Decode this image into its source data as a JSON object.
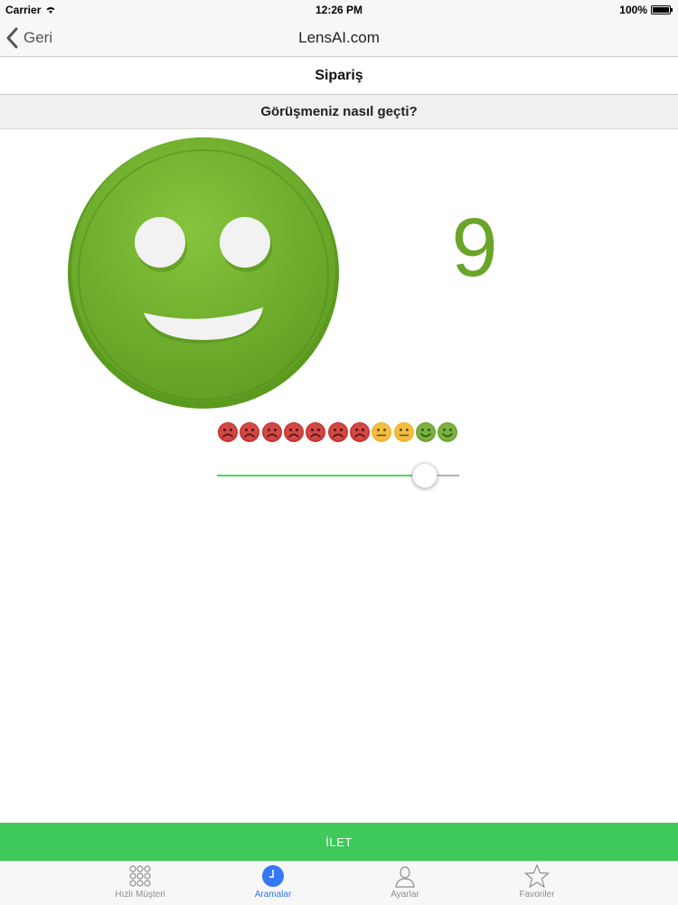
{
  "status_bar": {
    "carrier": "Carrier",
    "time": "12:26 PM",
    "battery": "100%"
  },
  "navbar": {
    "back_label": "Geri",
    "title": "LensAI.com"
  },
  "section_title": "Sipariş",
  "question": "Görüşmeniz nasıl geçti?",
  "rating": {
    "score_label": "9",
    "value": 9,
    "min": 0,
    "max": 10,
    "face": "happy-face-green",
    "scale_icons": [
      "sad-red",
      "sad-red",
      "sad-red",
      "sad-red",
      "sad-red",
      "sad-red",
      "sad-red",
      "neutral-yellow",
      "neutral-yellow",
      "happy-green",
      "happy-green"
    ],
    "colors": {
      "happy": "#6aa52a",
      "neutral": "#f0b429",
      "sad": "#c9302c",
      "slider_fill": "#4cd964",
      "slider_track": "#b5b5b5"
    }
  },
  "submit_label": "İLET",
  "tabs": [
    {
      "label": "Hızlı Müşteri",
      "icon": "grid-icon",
      "active": false
    },
    {
      "label": "Aramalar",
      "icon": "clock-icon",
      "active": true
    },
    {
      "label": "Ayarlar",
      "icon": "person-icon",
      "active": false
    },
    {
      "label": "Favoriler",
      "icon": "star-icon",
      "active": false
    }
  ],
  "accent_color": "#3ec95a"
}
